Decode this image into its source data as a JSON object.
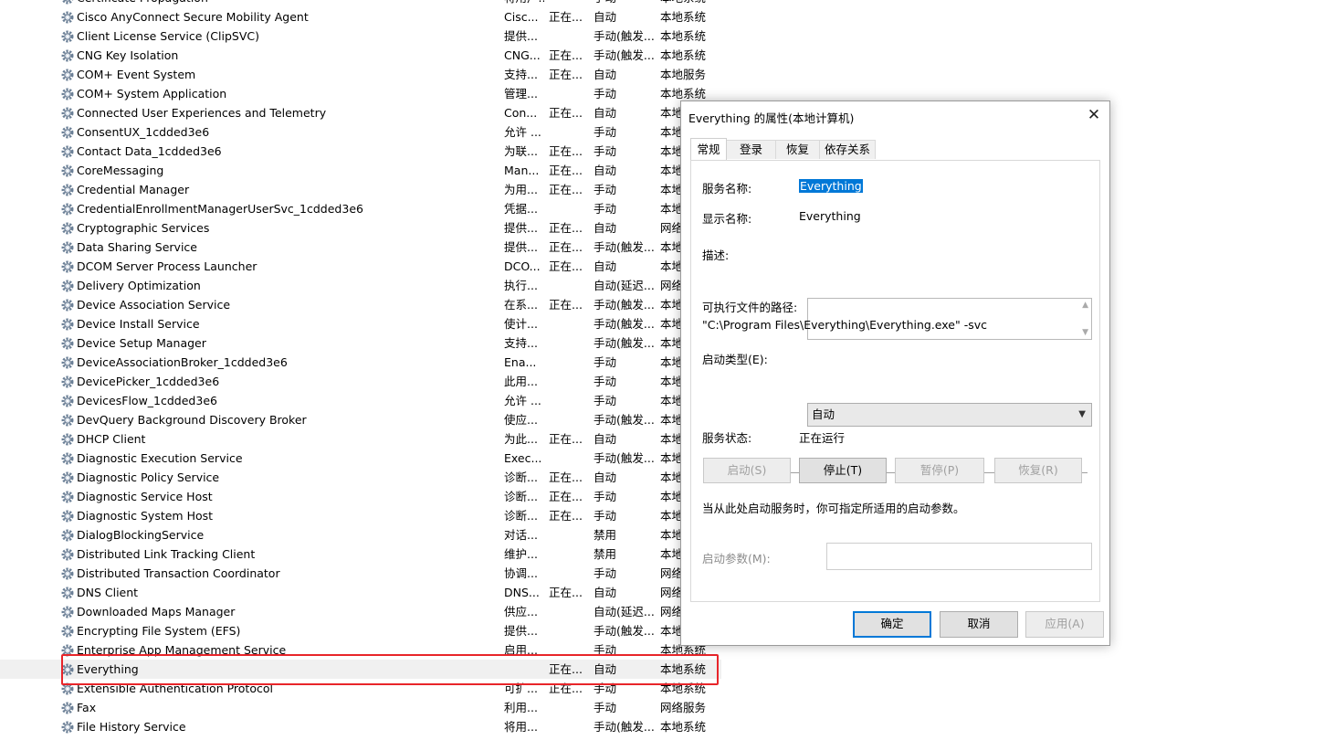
{
  "colors": {
    "selection": "#0078d7",
    "highlight_border": "#e8252a",
    "row_selected_bg": "#f0f0f0"
  },
  "services": [
    {
      "name": "Certificate Propagation",
      "desc": "将用户...",
      "status": "",
      "startup": "手动",
      "logon": "本地系统"
    },
    {
      "name": "Cisco AnyConnect Secure Mobility Agent",
      "desc": "Cisc...",
      "status": "正在...",
      "startup": "自动",
      "logon": "本地系统"
    },
    {
      "name": "Client License Service (ClipSVC)",
      "desc": "提供...",
      "status": "",
      "startup": "手动(触发...",
      "logon": "本地系统"
    },
    {
      "name": "CNG Key Isolation",
      "desc": "CNG...",
      "status": "正在...",
      "startup": "手动(触发...",
      "logon": "本地系统"
    },
    {
      "name": "COM+ Event System",
      "desc": "支持...",
      "status": "正在...",
      "startup": "自动",
      "logon": "本地服务"
    },
    {
      "name": "COM+ System Application",
      "desc": "管理...",
      "status": "",
      "startup": "手动",
      "logon": "本地系统"
    },
    {
      "name": "Connected User Experiences and Telemetry",
      "desc": "Con...",
      "status": "正在...",
      "startup": "自动",
      "logon": "本地系统"
    },
    {
      "name": "ConsentUX_1cdded3e6",
      "desc": "允许 ...",
      "status": "",
      "startup": "手动",
      "logon": "本地系统"
    },
    {
      "name": "Contact Data_1cdded3e6",
      "desc": "为联...",
      "status": "正在...",
      "startup": "手动",
      "logon": "本地系统"
    },
    {
      "name": "CoreMessaging",
      "desc": "Man...",
      "status": "正在...",
      "startup": "自动",
      "logon": "本地服务"
    },
    {
      "name": "Credential Manager",
      "desc": "为用...",
      "status": "正在...",
      "startup": "手动",
      "logon": "本地系统"
    },
    {
      "name": "CredentialEnrollmentManagerUserSvc_1cdded3e6",
      "desc": "凭据...",
      "status": "",
      "startup": "手动",
      "logon": "本地系统"
    },
    {
      "name": "Cryptographic Services",
      "desc": "提供...",
      "status": "正在...",
      "startup": "自动",
      "logon": "网络服务"
    },
    {
      "name": "Data Sharing Service",
      "desc": "提供...",
      "status": "正在...",
      "startup": "手动(触发...",
      "logon": "本地系统"
    },
    {
      "name": "DCOM Server Process Launcher",
      "desc": "DCO...",
      "status": "正在...",
      "startup": "自动",
      "logon": "本地系统"
    },
    {
      "name": "Delivery Optimization",
      "desc": "执行...",
      "status": "",
      "startup": "自动(延迟...",
      "logon": "网络服务"
    },
    {
      "name": "Device Association Service",
      "desc": "在系...",
      "status": "正在...",
      "startup": "手动(触发...",
      "logon": "本地系统"
    },
    {
      "name": "Device Install Service",
      "desc": "使计...",
      "status": "",
      "startup": "手动(触发...",
      "logon": "本地系统"
    },
    {
      "name": "Device Setup Manager",
      "desc": "支持...",
      "status": "",
      "startup": "手动(触发...",
      "logon": "本地系统"
    },
    {
      "name": "DeviceAssociationBroker_1cdded3e6",
      "desc": "Ena...",
      "status": "",
      "startup": "手动",
      "logon": "本地系统"
    },
    {
      "name": "DevicePicker_1cdded3e6",
      "desc": "此用...",
      "status": "",
      "startup": "手动",
      "logon": "本地系统"
    },
    {
      "name": "DevicesFlow_1cdded3e6",
      "desc": "允许 ...",
      "status": "",
      "startup": "手动",
      "logon": "本地系统"
    },
    {
      "name": "DevQuery Background Discovery Broker",
      "desc": "使应...",
      "status": "",
      "startup": "手动(触发...",
      "logon": "本地系统"
    },
    {
      "name": "DHCP Client",
      "desc": "为此...",
      "status": "正在...",
      "startup": "自动",
      "logon": "本地服务"
    },
    {
      "name": "Diagnostic Execution Service",
      "desc": "Exec...",
      "status": "",
      "startup": "手动(触发...",
      "logon": "本地系统"
    },
    {
      "name": "Diagnostic Policy Service",
      "desc": "诊断...",
      "status": "正在...",
      "startup": "自动",
      "logon": "本地服务"
    },
    {
      "name": "Diagnostic Service Host",
      "desc": "诊断...",
      "status": "正在...",
      "startup": "手动",
      "logon": "本地服务"
    },
    {
      "name": "Diagnostic System Host",
      "desc": "诊断...",
      "status": "正在...",
      "startup": "手动",
      "logon": "本地系统"
    },
    {
      "name": "DialogBlockingService",
      "desc": "对话...",
      "status": "",
      "startup": "禁用",
      "logon": "本地系统"
    },
    {
      "name": "Distributed Link Tracking Client",
      "desc": "维护...",
      "status": "",
      "startup": "禁用",
      "logon": "本地系统"
    },
    {
      "name": "Distributed Transaction Coordinator",
      "desc": "协调...",
      "status": "",
      "startup": "手动",
      "logon": "网络服务"
    },
    {
      "name": "DNS Client",
      "desc": "DNS...",
      "status": "正在...",
      "startup": "自动",
      "logon": "网络服务"
    },
    {
      "name": "Downloaded Maps Manager",
      "desc": "供应...",
      "status": "",
      "startup": "自动(延迟...",
      "logon": "网络服务"
    },
    {
      "name": "Encrypting File System (EFS)",
      "desc": "提供...",
      "status": "",
      "startup": "手动(触发...",
      "logon": "本地系统"
    },
    {
      "name": "Enterprise App Management Service",
      "desc": "启用...",
      "status": "",
      "startup": "手动",
      "logon": "本地系统"
    },
    {
      "name": "Everything",
      "desc": "",
      "status": "正在...",
      "startup": "自动",
      "logon": "本地系统",
      "selected": true
    },
    {
      "name": "Extensible Authentication Protocol",
      "desc": "可扩...",
      "status": "正在...",
      "startup": "手动",
      "logon": "本地系统"
    },
    {
      "name": "Fax",
      "desc": "利用...",
      "status": "",
      "startup": "手动",
      "logon": "网络服务"
    },
    {
      "name": "File History Service",
      "desc": "将用...",
      "status": "",
      "startup": "手动(触发...",
      "logon": "本地系统"
    }
  ],
  "dialog": {
    "title": "Everything 的属性(本地计算机)",
    "close": "✕",
    "tabs": [
      "常规",
      "登录",
      "恢复",
      "依存关系"
    ],
    "service_name_label": "服务名称:",
    "service_name": "Everything",
    "display_name_label": "显示名称:",
    "display_name": "Everything",
    "description_label": "描述:",
    "path_label": "可执行文件的路径:",
    "path": "\"C:\\Program Files\\Everything\\Everything.exe\" -svc",
    "startup_label": "启动类型(E):",
    "startup_value": "自动",
    "status_label": "服务状态:",
    "status_value": "正在运行",
    "buttons": {
      "start": "启动(S)",
      "stop": "停止(T)",
      "pause": "暂停(P)",
      "resume": "恢复(R)"
    },
    "hint": "当从此处启动服务时，你可指定所适用的启动参数。",
    "param_label": "启动参数(M):",
    "ok": "确定",
    "cancel": "取消",
    "apply": "应用(A)"
  }
}
